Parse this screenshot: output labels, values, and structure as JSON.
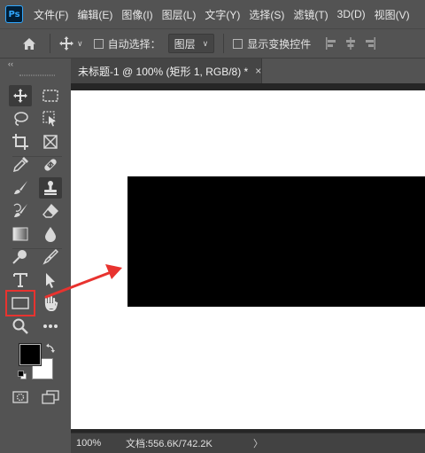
{
  "app": {
    "logo": "Ps"
  },
  "menu": [
    {
      "label": "文件(F)"
    },
    {
      "label": "编辑(E)"
    },
    {
      "label": "图像(I)"
    },
    {
      "label": "图层(L)"
    },
    {
      "label": "文字(Y)"
    },
    {
      "label": "选择(S)"
    },
    {
      "label": "滤镜(T)"
    },
    {
      "label": "3D(D)"
    },
    {
      "label": "视图(V)"
    }
  ],
  "options": {
    "auto_select_label": "自动选择：",
    "layer_select_value": "图层",
    "show_transform_label": "显示变换控件"
  },
  "collapse_label": "‹‹",
  "document": {
    "tab_title": "未标题-1 @ 100% (矩形 1, RGB/8) *",
    "tab_close": "×"
  },
  "status": {
    "zoom": "100%",
    "doc_info": "文档:556.6K/742.2K",
    "arrow": "〉"
  },
  "colors": {
    "foreground": "#000000",
    "background": "#ffffff",
    "annotation": "#e8332f"
  },
  "tools": [
    "move-tool-icon",
    "marquee-tool-icon",
    "lasso-tool-icon",
    "object-select-tool-icon",
    "crop-tool-icon",
    "frame-tool-icon",
    "eyedropper-tool-icon",
    "healing-brush-tool-icon",
    "brush-tool-icon",
    "clone-stamp-tool-icon",
    "history-brush-tool-icon",
    "eraser-tool-icon",
    "gradient-tool-icon",
    "blur-tool-icon",
    "dodge-tool-icon",
    "pen-tool-icon",
    "type-tool-icon",
    "path-select-tool-icon",
    "rectangle-tool-icon",
    "hand-tool-icon",
    "zoom-tool-icon",
    "more-tools-icon",
    "quick-mask-icon",
    "screen-mode-icon"
  ]
}
